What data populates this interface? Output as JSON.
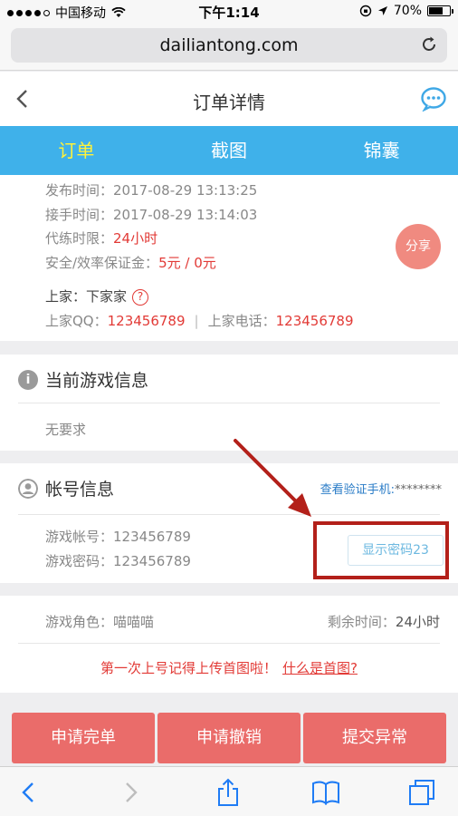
{
  "status_bar": {
    "carrier": "中国移动",
    "time": "下午1:14",
    "battery": "70%",
    "battery_level": 0.7
  },
  "browser": {
    "url": "dailiantong.com"
  },
  "header": {
    "title": "订单详情"
  },
  "tabs": [
    {
      "label": "订单"
    },
    {
      "label": "截图"
    },
    {
      "label": "锦囊"
    }
  ],
  "order": {
    "publish_label": "发布时间：",
    "publish_value": "2017-08-29 13:13:25",
    "accept_label": "接手时间：",
    "accept_value": "2017-08-29 13:14:03",
    "limit_label": "代练时限：",
    "limit_value": "24小时",
    "deposit_label": "安全/效率保证金：",
    "deposit_value": "5元 / 0元",
    "share_label": "分享",
    "seller_label": "上家：",
    "seller_value": "下家家",
    "help_glyph": "?",
    "qq_label": "上家QQ：",
    "qq_value": "123456789",
    "separator": "|",
    "phone_label": "上家电话：",
    "phone_value": "123456789"
  },
  "game_info": {
    "title": "当前游戏信息",
    "icon_glyph": "i",
    "content": "无要求"
  },
  "account": {
    "title": "帐号信息",
    "verify_link": "查看验证手机:",
    "verify_mask": "********",
    "account_label": "游戏帐号：",
    "account_value": "123456789",
    "password_label": "游戏密码：",
    "password_value": "123456789",
    "show_password_button": "显示密码23"
  },
  "role": {
    "role_label": "游戏角色：",
    "role_value": "喵喵喵",
    "remaining_label": "剩余时间：",
    "remaining_value": "24小时"
  },
  "notice": {
    "text": "第一次上号记得上传首图啦！",
    "link": "什么是首图?"
  },
  "actions": [
    {
      "label": "申请完单"
    },
    {
      "label": "申请撤销"
    },
    {
      "label": "提交异常"
    }
  ],
  "colors": {
    "tab_bg": "#3fb1ea",
    "tab_active": "#fff23a",
    "accent_red": "#e23a36",
    "action_bg": "#ea6c6a",
    "annotation": "#b3201a",
    "link_blue": "#2a7cc7"
  }
}
